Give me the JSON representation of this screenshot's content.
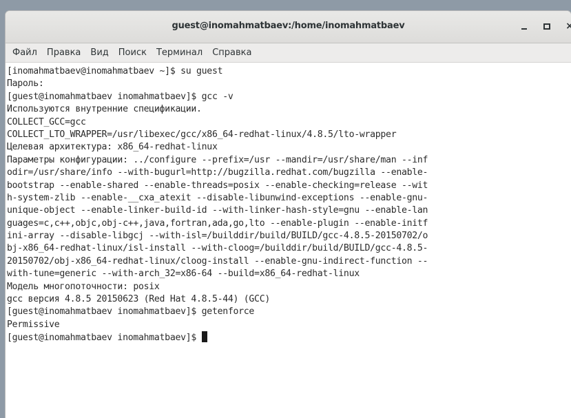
{
  "window": {
    "title": "guest@inomahmatbaev:/home/inomahmatbaev",
    "buttons": {
      "minimize": "_",
      "maximize": "□",
      "close": "×"
    }
  },
  "menu": {
    "items": [
      "Файл",
      "Правка",
      "Вид",
      "Поиск",
      "Терминал",
      "Справка"
    ]
  },
  "terminal": {
    "lines": [
      "[inomahmatbaev@inomahmatbaev ~]$ su guest",
      "Пароль:",
      "[guest@inomahmatbaev inomahmatbaev]$ gcc -v",
      "Используются внутренние спецификации.",
      "COLLECT_GCC=gcc",
      "COLLECT_LTO_WRAPPER=/usr/libexec/gcc/x86_64-redhat-linux/4.8.5/lto-wrapper",
      "Целевая архитектура: x86_64-redhat-linux",
      "Параметры конфигурации: ../configure --prefix=/usr --mandir=/usr/share/man --inf",
      "odir=/usr/share/info --with-bugurl=http://bugzilla.redhat.com/bugzilla --enable-",
      "bootstrap --enable-shared --enable-threads=posix --enable-checking=release --wit",
      "h-system-zlib --enable-__cxa_atexit --disable-libunwind-exceptions --enable-gnu-",
      "unique-object --enable-linker-build-id --with-linker-hash-style=gnu --enable-lan",
      "guages=c,c++,objc,obj-c++,java,fortran,ada,go,lto --enable-plugin --enable-initf",
      "ini-array --disable-libgcj --with-isl=/builddir/build/BUILD/gcc-4.8.5-20150702/o",
      "bj-x86_64-redhat-linux/isl-install --with-cloog=/builddir/build/BUILD/gcc-4.8.5-",
      "20150702/obj-x86_64-redhat-linux/cloog-install --enable-gnu-indirect-function --",
      "with-tune=generic --with-arch_32=x86-64 --build=x86_64-redhat-linux",
      "Модель многопоточности: posix",
      "gcc версия 4.8.5 20150623 (Red Hat 4.8.5-44) (GCC)",
      "[guest@inomahmatbaev inomahmatbaev]$ getenforce",
      "Permissive"
    ],
    "prompt": "[guest@inomahmatbaev inomahmatbaev]$ "
  }
}
